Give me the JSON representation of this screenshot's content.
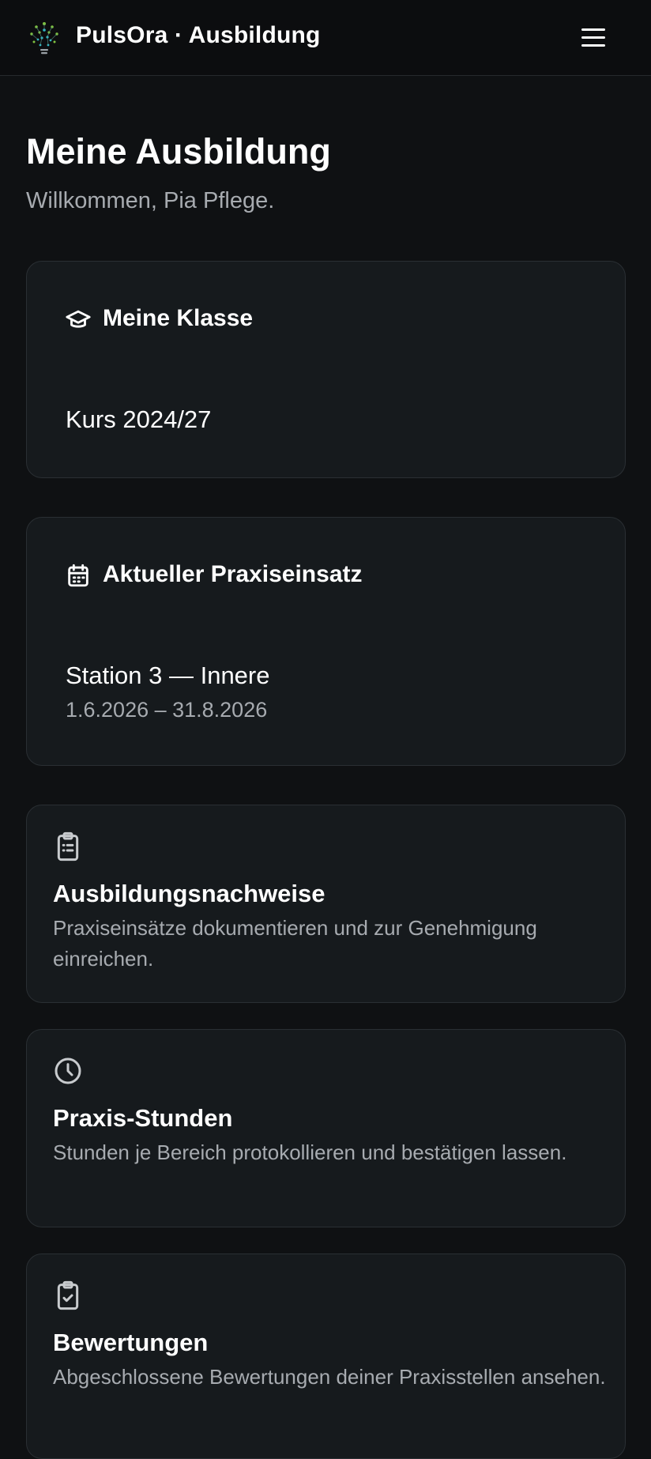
{
  "header": {
    "app_title": "PulsOra · Ausbildung",
    "logo_icon": "lightbulb-network-logo",
    "menu_icon": "hamburger-menu-icon"
  },
  "page": {
    "title": "Meine Ausbildung",
    "welcome": "Willkommen, Pia Pflege."
  },
  "class_card": {
    "icon": "graduation-cap-icon",
    "title": "Meine Klasse",
    "value": "Kurs 2024/27"
  },
  "placement_card": {
    "icon": "calendar-icon",
    "title": "Aktueller Praxiseinsatz",
    "value": "Station 3 — Innere",
    "dates": "1.6.2026 – 31.8.2026"
  },
  "features": [
    {
      "icon": "clipboard-list-icon",
      "title": "Ausbildungsnachweise",
      "description": "Praxiseinsätze dokumentieren und zur Genehmigung einreichen."
    },
    {
      "icon": "clock-icon",
      "title": "Praxis-Stunden",
      "description": "Stunden je Bereich protokollieren und bestätigen lassen."
    },
    {
      "icon": "clipboard-check-icon",
      "title": "Bewertungen",
      "description": "Abgeschlossene Bewertungen deiner Praxisstellen ansehen."
    }
  ],
  "colors": {
    "background": "#0f1113",
    "card": "#161a1d",
    "card_border": "#2a2f33",
    "muted_text": "#a7abb0",
    "logo_green": "#7fc241",
    "logo_cyan": "#2fb7c6"
  }
}
